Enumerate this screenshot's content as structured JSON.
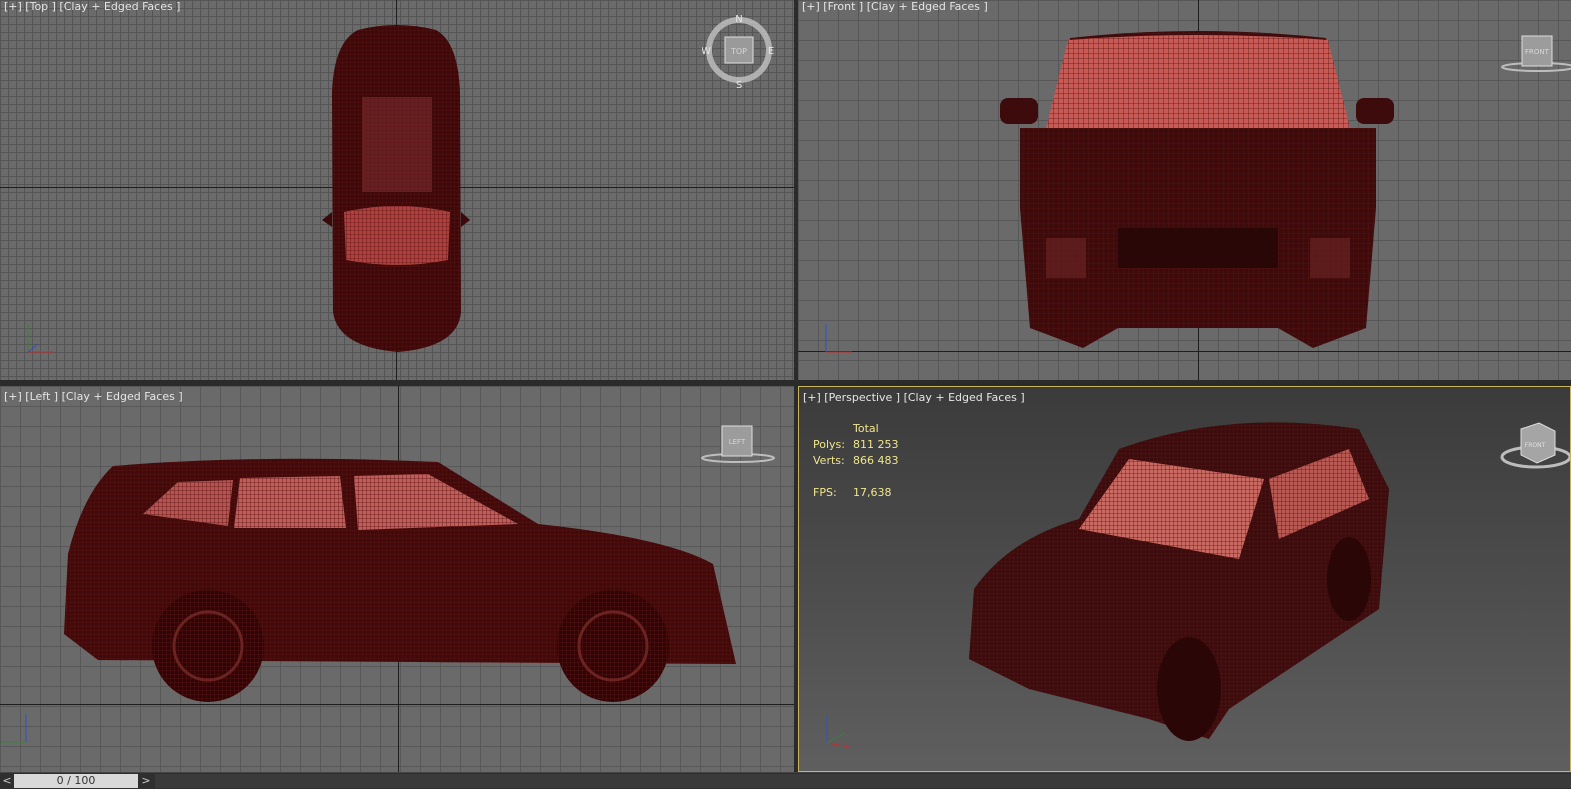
{
  "viewports": {
    "top": {
      "label": "[+] [Top ] [Clay + Edged Faces ]",
      "viewcube": {
        "face": "TOP",
        "north": "N",
        "south": "S",
        "east": "E",
        "west": "W"
      }
    },
    "front": {
      "label": "[+] [Front ] [Clay + Edged Faces ]",
      "viewcube": {
        "face": "FRONT"
      }
    },
    "left": {
      "label": "[+] [Left ] [Clay + Edged Faces ]",
      "viewcube": {
        "face": "LEFT"
      }
    },
    "perspective": {
      "label": "[+] [Perspective ] [Clay + Edged Faces ]",
      "viewcube": {
        "face": "FRONT"
      }
    }
  },
  "stats": {
    "header": "Total",
    "polys_label": "Polys:",
    "polys_value": "811 253",
    "verts_label": "Verts:",
    "verts_value": "866 483",
    "fps_label": "FPS:",
    "fps_value": "17,638"
  },
  "timeline": {
    "prev": "<",
    "next": ">",
    "frame": "0 / 100"
  },
  "colors": {
    "wire": "#5a1212",
    "clay": "#c25a55",
    "active_border": "#c8b45a"
  }
}
